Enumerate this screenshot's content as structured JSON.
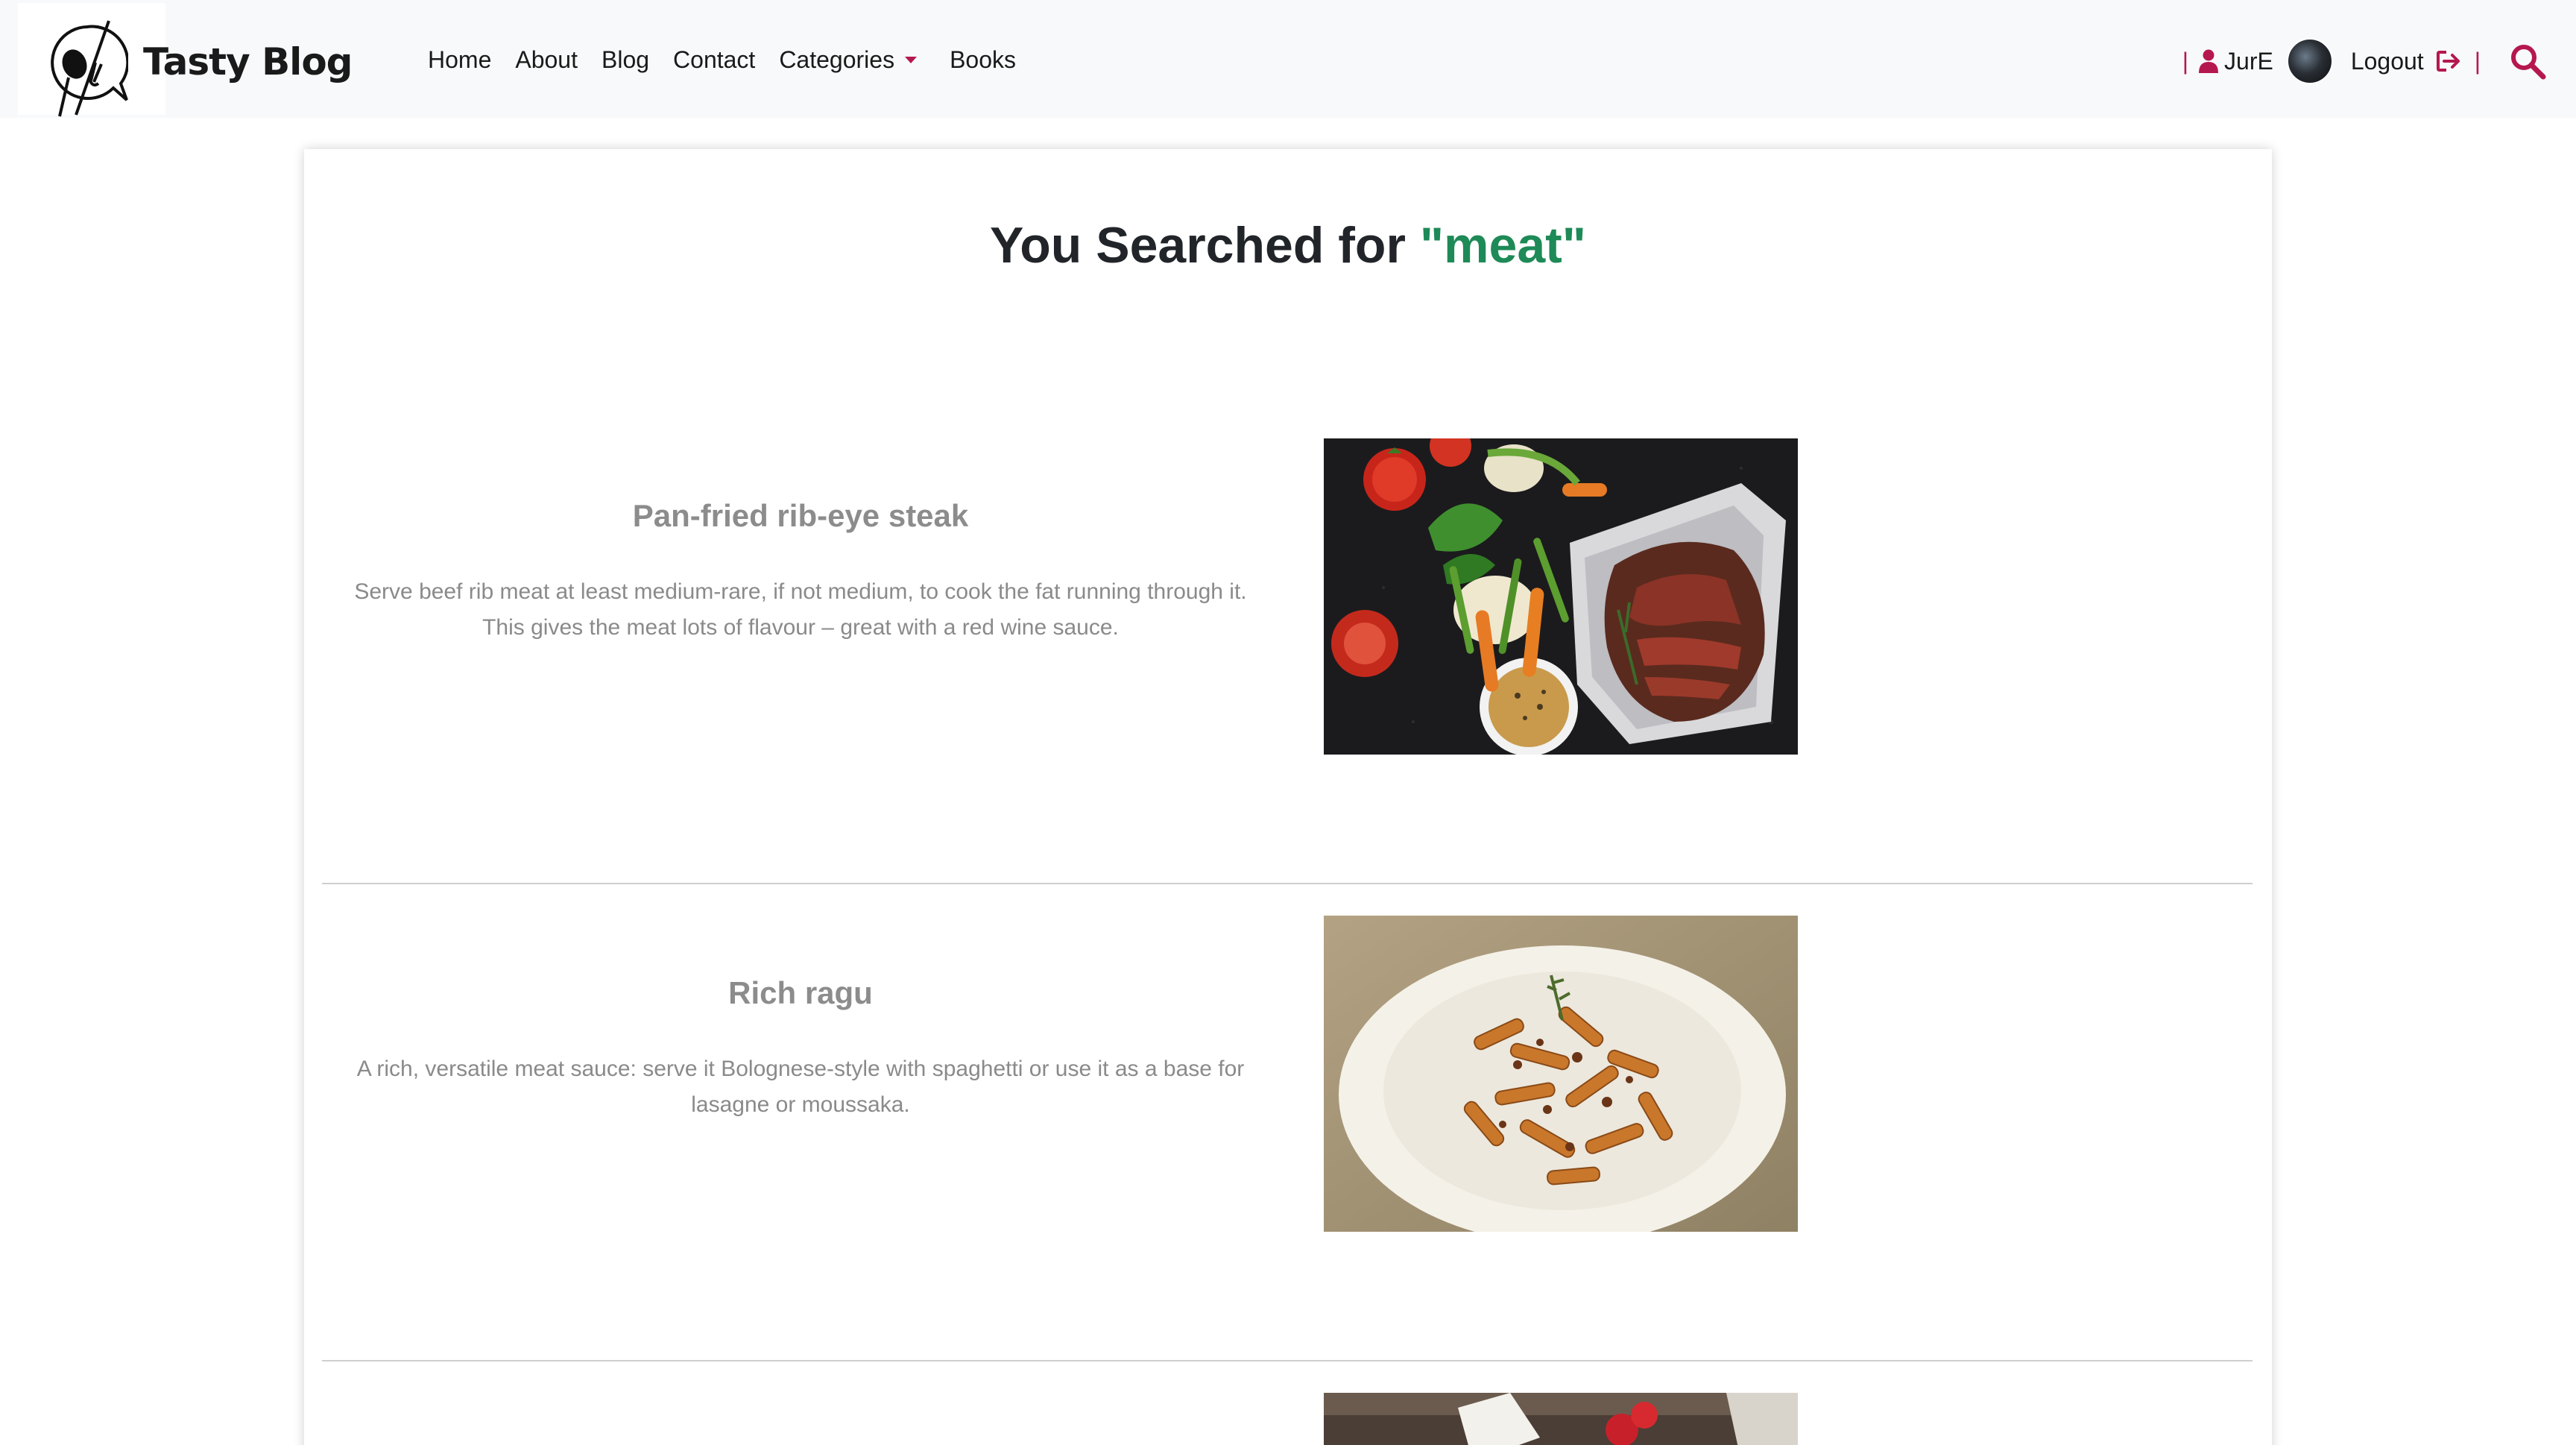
{
  "brand": {
    "name": "Tasty Blog"
  },
  "nav": {
    "home": "Home",
    "about": "About",
    "blog": "Blog",
    "contact": "Contact",
    "categories": "Categories",
    "books": "Books"
  },
  "user": {
    "separator": "|",
    "name": "JurE",
    "logout": "Logout"
  },
  "search": {
    "prefix": "You Searched for ",
    "term": "\"meat\""
  },
  "results": [
    {
      "title": "Pan-fried rib-eye steak",
      "description": "Serve beef rib meat at least medium-rare, if not medium, to cook the fat running through it. This gives the meat lots of flavour – great with a red wine sauce."
    },
    {
      "title": "Rich ragu",
      "description": "A rich, versatile meat sauce: serve it Bolognese-style with spaghetti or use it as a base for lasagne or moussaka."
    }
  ],
  "colors": {
    "accent": "#b5174f",
    "search_term": "#1e8a57",
    "navbar_bg": "#f8f9fa"
  },
  "icons": [
    "logo-icon",
    "user-icon",
    "logout-icon",
    "search-icon",
    "caret-down-icon"
  ]
}
